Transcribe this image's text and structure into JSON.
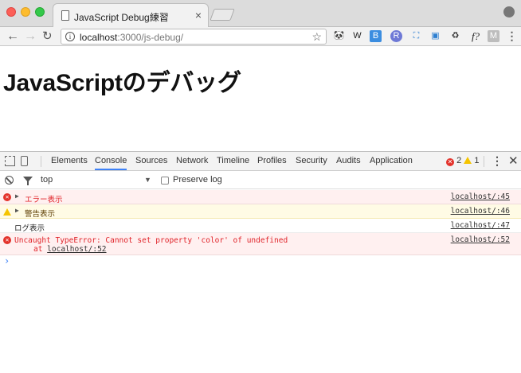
{
  "browser": {
    "tab": {
      "title": "JavaScript Debug練習",
      "close_glyph": "×"
    },
    "toolbar": {
      "back_glyph": "←",
      "forward_glyph": "→",
      "reload_glyph": "↻",
      "url_host": "localhost",
      "url_path": ":3000/js-debug/",
      "info_glyph": "i",
      "star_glyph": "☆"
    },
    "extensions": [
      {
        "name": "panda-icon",
        "glyph": "🐼"
      },
      {
        "name": "w-icon",
        "glyph": "W"
      },
      {
        "name": "b-icon",
        "glyph": "B"
      },
      {
        "name": "r-icon",
        "glyph": "R"
      },
      {
        "name": "frame-icon",
        "glyph": "⛶"
      },
      {
        "name": "image-icon",
        "glyph": "▣"
      },
      {
        "name": "recycle-icon",
        "glyph": "♻"
      },
      {
        "name": "function-icon",
        "glyph": "f?"
      },
      {
        "name": "m-icon",
        "glyph": "M"
      },
      {
        "name": "menu-icon",
        "glyph": "⋮"
      }
    ]
  },
  "page": {
    "heading": "JavaScriptのデバッグ"
  },
  "devtools": {
    "tabs": [
      "Elements",
      "Console",
      "Sources",
      "Network",
      "Timeline",
      "Profiles",
      "Security",
      "Audits",
      "Application"
    ],
    "active_tab": "Console",
    "error_count": "2",
    "warning_count": "1",
    "kebab_glyph": "⋮",
    "close_glyph": "✕",
    "console_toolbar": {
      "context": "top",
      "context_arrow": "▼",
      "preserve_log_label": "Preserve log",
      "preserve_log_checked": false
    },
    "messages": [
      {
        "level": "error",
        "text": "エラー表示",
        "source": "localhost/:45",
        "expandable": true
      },
      {
        "level": "warning",
        "text": "警告表示",
        "source": "localhost/:46",
        "expandable": true
      },
      {
        "level": "log",
        "text": "ログ表示",
        "source": "localhost/:47",
        "expandable": false
      },
      {
        "level": "error",
        "text": "Uncaught TypeError: Cannot set property 'color' of undefined",
        "stack_prefix": "at ",
        "stack_link": "localhost/:52",
        "source": "localhost/:52",
        "expandable": false
      }
    ],
    "prompt_glyph": "›"
  },
  "colors": {
    "error_red": "#e0242a",
    "error_bg": "#fff0f0",
    "warning_bg": "#fffbe5",
    "warning_yellow": "#f5c400",
    "accent_blue": "#3e82f7"
  }
}
